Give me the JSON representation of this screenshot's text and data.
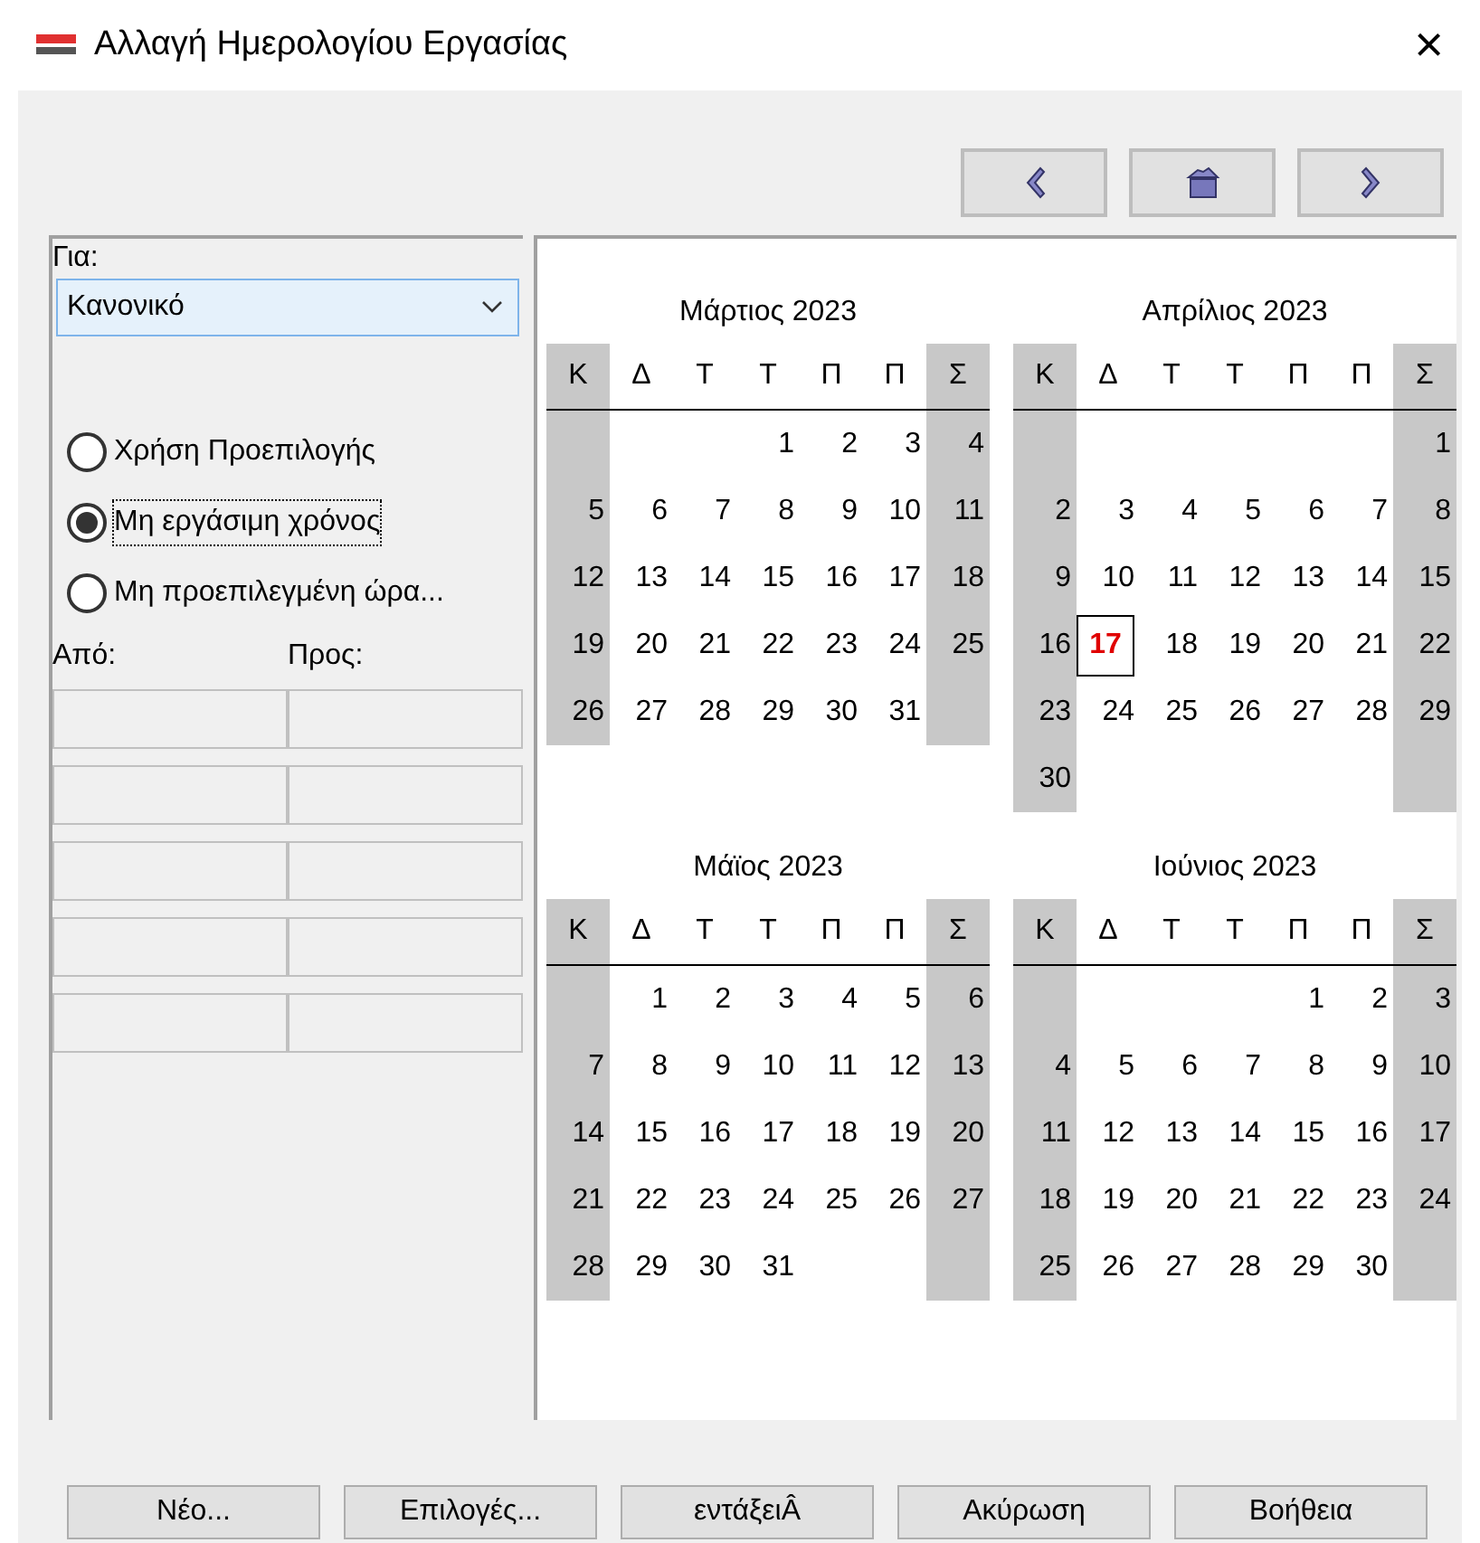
{
  "window": {
    "title": "Αλλαγή Ημερολογίου Εργασίας",
    "close": "×"
  },
  "for_label": "Για:",
  "calendar_select": {
    "value": "Κανονικό"
  },
  "radios": [
    {
      "label": "Χρήση Προεπιλογής",
      "selected": false,
      "focused": false
    },
    {
      "label": "Μη εργάσιμη χρόνος",
      "selected": true,
      "focused": true
    },
    {
      "label": "Μη προεπιλεγμένη ώρα...",
      "selected": false,
      "focused": false
    }
  ],
  "time_columns": [
    "Από:",
    "Προς:"
  ],
  "time_rows": [
    {
      "from": {
        "kind": "empty"
      },
      "to": {
        "kind": "empty"
      }
    },
    {
      "from": {
        "kind": "empty"
      },
      "to": {
        "kind": "empty"
      }
    },
    {
      "from": {
        "kind": "empty"
      },
      "to": {
        "kind": "empty"
      }
    },
    {
      "from": {
        "kind": "empty"
      },
      "to": {
        "kind": "empty"
      }
    },
    {
      "from": {
        "kind": "empty"
      },
      "to": {
        "kind": "empty"
      }
    }
  ],
  "months": [
    {
      "title": "Μάρτιος 2023",
      "weekdays": [
        "Κ",
        "Δ",
        "Τ",
        "Τ",
        "Π",
        "Π",
        "Σ"
      ],
      "weeks": [
        [
          {
            "kind": "blank"
          },
          {
            "kind": "blank"
          },
          {
            "kind": "blank"
          },
          {
            "kind": "day",
            "day": "1",
            "today": false
          },
          {
            "kind": "day",
            "day": "2",
            "today": false
          },
          {
            "kind": "day",
            "day": "3",
            "today": false
          },
          {
            "kind": "day",
            "day": "4",
            "today": false
          }
        ],
        [
          {
            "kind": "day",
            "day": "5",
            "today": false
          },
          {
            "kind": "day",
            "day": "6",
            "today": false
          },
          {
            "kind": "day",
            "day": "7",
            "today": false
          },
          {
            "kind": "day",
            "day": "8",
            "today": false
          },
          {
            "kind": "day",
            "day": "9",
            "today": false
          },
          {
            "kind": "day",
            "day": "10",
            "today": false
          },
          {
            "kind": "day",
            "day": "11",
            "today": false
          }
        ],
        [
          {
            "kind": "day",
            "day": "12",
            "today": false
          },
          {
            "kind": "day",
            "day": "13",
            "today": false
          },
          {
            "kind": "day",
            "day": "14",
            "today": false
          },
          {
            "kind": "day",
            "day": "15",
            "today": false
          },
          {
            "kind": "day",
            "day": "16",
            "today": false
          },
          {
            "kind": "day",
            "day": "17",
            "today": false
          },
          {
            "kind": "day",
            "day": "18",
            "today": false
          }
        ],
        [
          {
            "kind": "day",
            "day": "19",
            "today": false
          },
          {
            "kind": "day",
            "day": "20",
            "today": false
          },
          {
            "kind": "day",
            "day": "21",
            "today": false
          },
          {
            "kind": "day",
            "day": "22",
            "today": false
          },
          {
            "kind": "day",
            "day": "23",
            "today": false
          },
          {
            "kind": "day",
            "day": "24",
            "today": false
          },
          {
            "kind": "day",
            "day": "25",
            "today": false
          }
        ],
        [
          {
            "kind": "day",
            "day": "26",
            "today": false
          },
          {
            "kind": "day",
            "day": "27",
            "today": false
          },
          {
            "kind": "day",
            "day": "28",
            "today": false
          },
          {
            "kind": "day",
            "day": "29",
            "today": false
          },
          {
            "kind": "day",
            "day": "30",
            "today": false
          },
          {
            "kind": "day",
            "day": "31",
            "today": false
          }
        ]
      ]
    },
    {
      "title": "Απρίλιος 2023",
      "weekdays": [
        "Κ",
        "Δ",
        "Τ",
        "Τ",
        "Π",
        "Π",
        "Σ"
      ],
      "weeks": [
        [
          {
            "kind": "blank"
          },
          {
            "kind": "blank"
          },
          {
            "kind": "blank"
          },
          {
            "kind": "blank"
          },
          {
            "kind": "blank"
          },
          {
            "kind": "blank"
          },
          {
            "kind": "day",
            "day": "1",
            "today": false
          }
        ],
        [
          {
            "kind": "day",
            "day": "2",
            "today": false
          },
          {
            "kind": "day",
            "day": "3",
            "today": false
          },
          {
            "kind": "day",
            "day": "4",
            "today": false
          },
          {
            "kind": "day",
            "day": "5",
            "today": false
          },
          {
            "kind": "day",
            "day": "6",
            "today": false
          },
          {
            "kind": "day",
            "day": "7",
            "today": false
          },
          {
            "kind": "day",
            "day": "8",
            "today": false
          }
        ],
        [
          {
            "kind": "day",
            "day": "9",
            "today": false
          },
          {
            "kind": "day",
            "day": "10",
            "today": false
          },
          {
            "kind": "day",
            "day": "11",
            "today": false
          },
          {
            "kind": "day",
            "day": "12",
            "today": false
          },
          {
            "kind": "day",
            "day": "13",
            "today": false
          },
          {
            "kind": "day",
            "day": "14",
            "today": false
          },
          {
            "kind": "day",
            "day": "15",
            "today": false
          }
        ],
        [
          {
            "kind": "day",
            "day": "16",
            "today": false
          },
          {
            "kind": "day",
            "day": "17",
            "today": true
          },
          {
            "kind": "day",
            "day": "18",
            "today": false
          },
          {
            "kind": "day",
            "day": "19",
            "today": false
          },
          {
            "kind": "day",
            "day": "20",
            "today": false
          },
          {
            "kind": "day",
            "day": "21",
            "today": false
          },
          {
            "kind": "day",
            "day": "22",
            "today": false
          }
        ],
        [
          {
            "kind": "day",
            "day": "23",
            "today": false
          },
          {
            "kind": "day",
            "day": "24",
            "today": false
          },
          {
            "kind": "day",
            "day": "25",
            "today": false
          },
          {
            "kind": "day",
            "day": "26",
            "today": false
          },
          {
            "kind": "day",
            "day": "27",
            "today": false
          },
          {
            "kind": "day",
            "day": "28",
            "today": false
          },
          {
            "kind": "day",
            "day": "29",
            "today": false
          }
        ],
        [
          {
            "kind": "day",
            "day": "30",
            "today": false
          }
        ]
      ]
    },
    {
      "title": "Μάϊος 2023",
      "weekdays": [
        "Κ",
        "Δ",
        "Τ",
        "Τ",
        "Π",
        "Π",
        "Σ"
      ],
      "weeks": [
        [
          {
            "kind": "blank"
          },
          {
            "kind": "day",
            "day": "1",
            "today": false
          },
          {
            "kind": "day",
            "day": "2",
            "today": false
          },
          {
            "kind": "day",
            "day": "3",
            "today": false
          },
          {
            "kind": "day",
            "day": "4",
            "today": false
          },
          {
            "kind": "day",
            "day": "5",
            "today": false
          },
          {
            "kind": "day",
            "day": "6",
            "today": false
          }
        ],
        [
          {
            "kind": "day",
            "day": "7",
            "today": false
          },
          {
            "kind": "day",
            "day": "8",
            "today": false
          },
          {
            "kind": "day",
            "day": "9",
            "today": false
          },
          {
            "kind": "day",
            "day": "10",
            "today": false
          },
          {
            "kind": "day",
            "day": "11",
            "today": false
          },
          {
            "kind": "day",
            "day": "12",
            "today": false
          },
          {
            "kind": "day",
            "day": "13",
            "today": false
          }
        ],
        [
          {
            "kind": "day",
            "day": "14",
            "today": false
          },
          {
            "kind": "day",
            "day": "15",
            "today": false
          },
          {
            "kind": "day",
            "day": "16",
            "today": false
          },
          {
            "kind": "day",
            "day": "17",
            "today": false
          },
          {
            "kind": "day",
            "day": "18",
            "today": false
          },
          {
            "kind": "day",
            "day": "19",
            "today": false
          },
          {
            "kind": "day",
            "day": "20",
            "today": false
          }
        ],
        [
          {
            "kind": "day",
            "day": "21",
            "today": false
          },
          {
            "kind": "day",
            "day": "22",
            "today": false
          },
          {
            "kind": "day",
            "day": "23",
            "today": false
          },
          {
            "kind": "day",
            "day": "24",
            "today": false
          },
          {
            "kind": "day",
            "day": "25",
            "today": false
          },
          {
            "kind": "day",
            "day": "26",
            "today": false
          },
          {
            "kind": "day",
            "day": "27",
            "today": false
          }
        ],
        [
          {
            "kind": "day",
            "day": "28",
            "today": false
          },
          {
            "kind": "day",
            "day": "29",
            "today": false
          },
          {
            "kind": "day",
            "day": "30",
            "today": false
          },
          {
            "kind": "day",
            "day": "31",
            "today": false
          }
        ]
      ]
    },
    {
      "title": "Ιούνιος 2023",
      "weekdays": [
        "Κ",
        "Δ",
        "Τ",
        "Τ",
        "Π",
        "Π",
        "Σ"
      ],
      "weeks": [
        [
          {
            "kind": "blank"
          },
          {
            "kind": "blank"
          },
          {
            "kind": "blank"
          },
          {
            "kind": "blank"
          },
          {
            "kind": "day",
            "day": "1",
            "today": false
          },
          {
            "kind": "day",
            "day": "2",
            "today": false
          },
          {
            "kind": "day",
            "day": "3",
            "today": false
          }
        ],
        [
          {
            "kind": "day",
            "day": "4",
            "today": false
          },
          {
            "kind": "day",
            "day": "5",
            "today": false
          },
          {
            "kind": "day",
            "day": "6",
            "today": false
          },
          {
            "kind": "day",
            "day": "7",
            "today": false
          },
          {
            "kind": "day",
            "day": "8",
            "today": false
          },
          {
            "kind": "day",
            "day": "9",
            "today": false
          },
          {
            "kind": "day",
            "day": "10",
            "today": false
          }
        ],
        [
          {
            "kind": "day",
            "day": "11",
            "today": false
          },
          {
            "kind": "day",
            "day": "12",
            "today": false
          },
          {
            "kind": "day",
            "day": "13",
            "today": false
          },
          {
            "kind": "day",
            "day": "14",
            "today": false
          },
          {
            "kind": "day",
            "day": "15",
            "today": false
          },
          {
            "kind": "day",
            "day": "16",
            "today": false
          },
          {
            "kind": "day",
            "day": "17",
            "today": false
          }
        ],
        [
          {
            "kind": "day",
            "day": "18",
            "today": false
          },
          {
            "kind": "day",
            "day": "19",
            "today": false
          },
          {
            "kind": "day",
            "day": "20",
            "today": false
          },
          {
            "kind": "day",
            "day": "21",
            "today": false
          },
          {
            "kind": "day",
            "day": "22",
            "today": false
          },
          {
            "kind": "day",
            "day": "23",
            "today": false
          },
          {
            "kind": "day",
            "day": "24",
            "today": false
          }
        ],
        [
          {
            "kind": "day",
            "day": "25",
            "today": false
          },
          {
            "kind": "day",
            "day": "26",
            "today": false
          },
          {
            "kind": "day",
            "day": "27",
            "today": false
          },
          {
            "kind": "day",
            "day": "28",
            "today": false
          },
          {
            "kind": "day",
            "day": "29",
            "today": false
          },
          {
            "kind": "day",
            "day": "30",
            "today": false
          }
        ]
      ]
    }
  ],
  "buttons": [
    "Νέο...",
    "Επιλογές...",
    "εντάξειÂ",
    "Ακύρωση",
    "Βοήθεια"
  ]
}
